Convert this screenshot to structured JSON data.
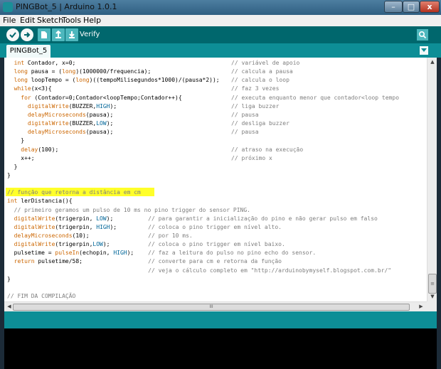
{
  "window": {
    "title": "PINGBot_5 | Arduino 1.0.1",
    "minimize_glyph": "–",
    "maximize_glyph": "□",
    "close_glyph": "x"
  },
  "menu": [
    "File",
    "Edit",
    "Sketch",
    "Tools",
    "Help"
  ],
  "toolbar": {
    "verify_label": "Verify",
    "icons": [
      "verify-icon",
      "upload-icon",
      "new-icon",
      "open-icon",
      "save-icon",
      "serial-monitor-icon"
    ]
  },
  "tabs": [
    {
      "label": "PINGBot_5"
    }
  ],
  "editor": {
    "lines": [
      {
        "indent": 2,
        "tokens": [
          [
            "kw",
            "int"
          ],
          [
            "t",
            " Contador, x=0;"
          ]
        ],
        "comment": "// variável de apoio"
      },
      {
        "indent": 2,
        "tokens": [
          [
            "kw",
            "long"
          ],
          [
            "t",
            " pausa = ("
          ],
          [
            "kw",
            "long"
          ],
          [
            "t",
            ")(1000000/frequencia);"
          ]
        ],
        "comment": "// calcula a pausa"
      },
      {
        "indent": 2,
        "tokens": [
          [
            "kw",
            "long"
          ],
          [
            "t",
            " loopTempo = ("
          ],
          [
            "kw",
            "long"
          ],
          [
            "t",
            ")((tempoMilisegundos*1000)/(pausa*2));"
          ]
        ],
        "comment": "// calcula o loop"
      },
      {
        "indent": 2,
        "tokens": [
          [
            "kw",
            "while"
          ],
          [
            "t",
            "(x<3){"
          ]
        ],
        "comment": "// faz 3 vezes"
      },
      {
        "indent": 4,
        "tokens": [
          [
            "kw",
            "for"
          ],
          [
            "t",
            " (Contador=0;Contador<loopTempo;Contador++){"
          ]
        ],
        "comment": "// executa enquanto menor que contador<loop tempo"
      },
      {
        "indent": 6,
        "tokens": [
          [
            "fn",
            "digitalWrite"
          ],
          [
            "t",
            "(BUZZER,"
          ],
          [
            "cst",
            "HIGH"
          ],
          [
            "t",
            ");"
          ]
        ],
        "comment": "// liga buzzer"
      },
      {
        "indent": 6,
        "tokens": [
          [
            "fn",
            "delayMicroseconds"
          ],
          [
            "t",
            "(pausa);"
          ]
        ],
        "comment": "// pausa"
      },
      {
        "indent": 6,
        "tokens": [
          [
            "fn",
            "digitalWrite"
          ],
          [
            "t",
            "(BUZZER,"
          ],
          [
            "cst",
            "LOW"
          ],
          [
            "t",
            ");"
          ]
        ],
        "comment": "// desliga buzzer"
      },
      {
        "indent": 6,
        "tokens": [
          [
            "fn",
            "delayMicroseconds"
          ],
          [
            "t",
            "(pausa);"
          ]
        ],
        "comment": "// pausa"
      },
      {
        "indent": 4,
        "tokens": [
          [
            "t",
            "}"
          ]
        ],
        "comment": ""
      },
      {
        "indent": 4,
        "tokens": [
          [
            "fn",
            "delay"
          ],
          [
            "t",
            "(100);"
          ]
        ],
        "comment": "// atraso na execução"
      },
      {
        "indent": 4,
        "tokens": [
          [
            "t",
            "x++;"
          ]
        ],
        "comment": "// próximo x"
      },
      {
        "indent": 2,
        "tokens": [
          [
            "t",
            "}"
          ]
        ],
        "comment": ""
      },
      {
        "indent": 0,
        "tokens": [
          [
            "t",
            "}"
          ]
        ],
        "comment": ""
      },
      {
        "indent": 0,
        "tokens": [],
        "comment": ""
      },
      {
        "indent": 0,
        "tokens": [
          [
            "cm",
            "// função que retorna a distância em cm"
          ]
        ],
        "comment": ""
      },
      {
        "indent": 0,
        "tokens": [
          [
            "kw",
            "int"
          ],
          [
            "t",
            " lerDistancia(){"
          ]
        ],
        "comment": ""
      },
      {
        "indent": 2,
        "tokens": [
          [
            "cm",
            "// primeiro geramos um pulso de 10 ms no pino trigger do sensor PING."
          ]
        ],
        "comment": ""
      },
      {
        "indent": 2,
        "tokens": [
          [
            "fn",
            "digitalWrite"
          ],
          [
            "t",
            "(trigerpin, "
          ],
          [
            "cst",
            "LOW"
          ],
          [
            "t",
            ");"
          ]
        ],
        "comment": "// para garantir a inicialização do pino e não gerar pulso em falso",
        "col": 27
      },
      {
        "indent": 2,
        "tokens": [
          [
            "fn",
            "digitalWrite"
          ],
          [
            "t",
            "(trigerpin, "
          ],
          [
            "cst",
            "HIGH"
          ],
          [
            "t",
            ");"
          ]
        ],
        "comment": "// coloca o pino trigger em nível alto.",
        "col": 27
      },
      {
        "indent": 2,
        "tokens": [
          [
            "fn",
            "delayMicroseconds"
          ],
          [
            "t",
            "(10);"
          ]
        ],
        "comment": "// por 10 ms.",
        "col": 27
      },
      {
        "indent": 2,
        "tokens": [
          [
            "fn",
            "digitalWrite"
          ],
          [
            "t",
            "(trigerpin,"
          ],
          [
            "cst",
            "LOW"
          ],
          [
            "t",
            ");"
          ]
        ],
        "comment": "// coloca o pino trigger em nível baixo.",
        "col": 27
      },
      {
        "indent": 2,
        "tokens": [
          [
            "t",
            "pulsetime = "
          ],
          [
            "fn",
            "pulseIn"
          ],
          [
            "t",
            "(echopin, "
          ],
          [
            "cst",
            "HIGH"
          ],
          [
            "t",
            ");"
          ]
        ],
        "comment": "// faz a leitura do pulso no pino echo do sensor.",
        "col": 27
      },
      {
        "indent": 2,
        "tokens": [
          [
            "kw",
            "return"
          ],
          [
            "t",
            " pulsetime/58;"
          ]
        ],
        "comment": "// converte para cm e retorna da função",
        "col": 27
      },
      {
        "indent": 2,
        "tokens": [],
        "comment": "// veja o cálculo completo em \"http://arduinobymyself.blogspot.com.br/\"",
        "col": 27
      },
      {
        "indent": 0,
        "tokens": [
          [
            "t",
            "}"
          ]
        ],
        "comment": ""
      },
      {
        "indent": 0,
        "tokens": [],
        "comment": ""
      },
      {
        "indent": 0,
        "tokens": [
          [
            "cm",
            "// FIM DA COMPILAÇÃO"
          ]
        ],
        "comment": ""
      }
    ]
  },
  "scrollbars": {
    "up": "▲",
    "down": "▼",
    "left": "◀",
    "right": "▶",
    "grip": "≡",
    "hgrip": "III"
  },
  "colors": {
    "toolbar": "#00676d",
    "tabstrip": "#0d8e96",
    "keyword": "#cc6600",
    "constant": "#006699",
    "comment": "#7e7e7e",
    "highlight": "#ffff2a",
    "console": "#000000"
  }
}
